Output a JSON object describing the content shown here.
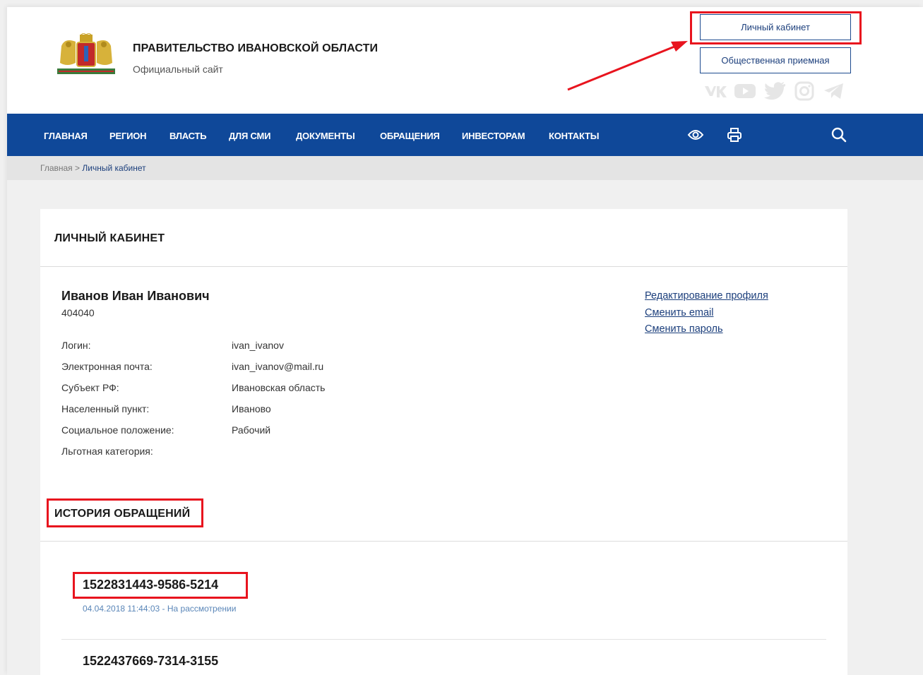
{
  "header": {
    "title": "ПРАВИТЕЛЬСТВО ИВАНОВСКОЙ ОБЛАСТИ",
    "subtitle": "Официальный сайт",
    "cabinet_button": "Личный кабинет",
    "reception_button": "Общественная приемная",
    "socials": [
      "vk-icon",
      "youtube-icon",
      "twitter-icon",
      "instagram-icon",
      "telegram-icon"
    ]
  },
  "nav": {
    "items": [
      "ГЛАВНАЯ",
      "РЕГИОН",
      "ВЛАСТЬ",
      "ДЛЯ СМИ",
      "ДОКУМЕНТЫ",
      "ОБРАЩЕНИЯ",
      "ИНВЕСТОРАМ",
      "КОНТАКТЫ"
    ],
    "icons": [
      "eye-icon",
      "print-icon",
      "search-icon"
    ]
  },
  "breadcrumb": {
    "home": "Главная",
    "separator": " > ",
    "current": "Личный кабинет"
  },
  "profile": {
    "section_title": "ЛИЧНЫЙ КАБИНЕТ",
    "name": "Иванов Иван Иванович",
    "id": "404040",
    "fields": [
      {
        "label": "Логин:",
        "value": "ivan_ivanov"
      },
      {
        "label": "Электронная почта:",
        "value": "ivan_ivanov@mail.ru"
      },
      {
        "label": "Субъект РФ:",
        "value": "Ивановская область"
      },
      {
        "label": "Населенный пункт:",
        "value": "Иваново"
      },
      {
        "label": "Социальное положение:",
        "value": "Рабочий"
      },
      {
        "label": "Льготная категория:",
        "value": ""
      }
    ],
    "links": [
      "Редактирование профиля",
      "Сменить email",
      "Сменить пароль"
    ]
  },
  "history": {
    "title": "ИСТОРИЯ ОБРАЩЕНИЙ",
    "items": [
      {
        "number": "1522831443-9586-5214",
        "meta": "04.04.2018 11:44:03 - На рассмотрении"
      },
      {
        "number": "1522437669-7314-3155",
        "meta": ""
      }
    ]
  },
  "colors": {
    "nav_bg": "#0f4899",
    "link": "#1c3f7c",
    "highlight": "#e8141e"
  }
}
